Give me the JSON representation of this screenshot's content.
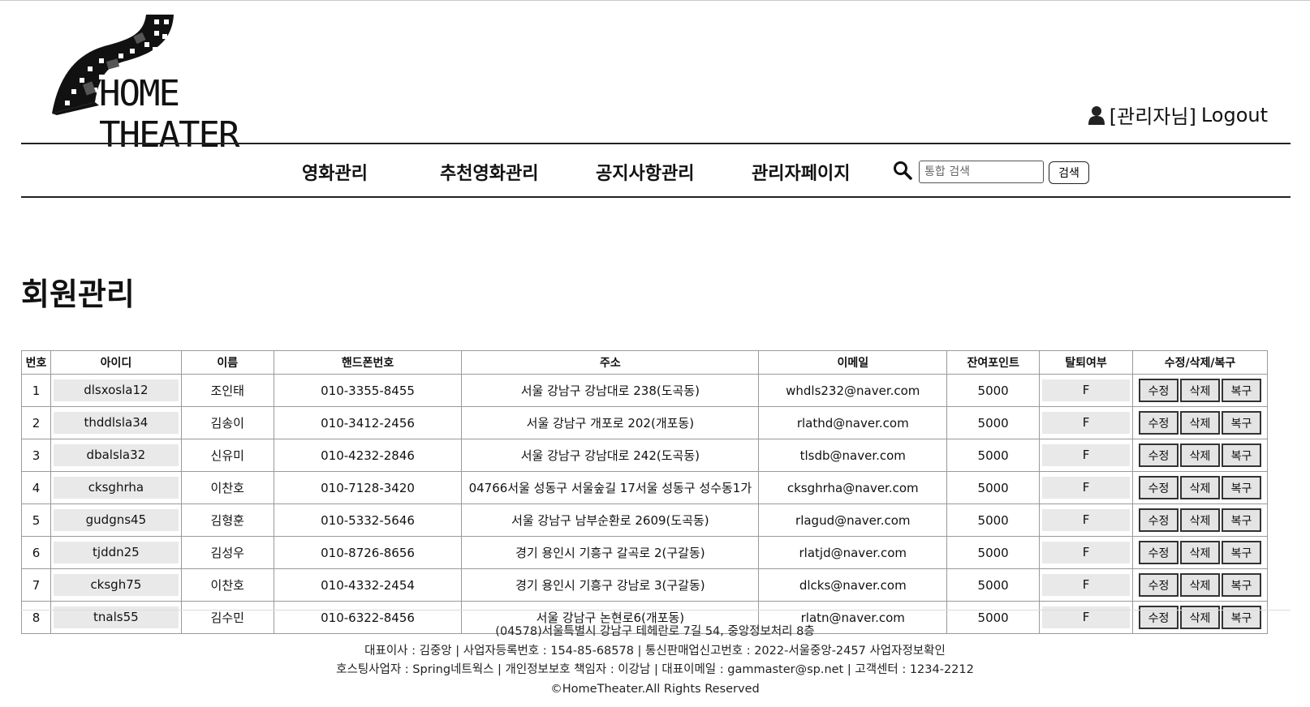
{
  "header": {
    "logo_text": "HOME THEATER",
    "user_label": "[관리자님]",
    "logout_label": "Logout"
  },
  "nav": {
    "items": [
      {
        "label": "영화관리"
      },
      {
        "label": "추천영화관리"
      },
      {
        "label": "공지사항관리"
      },
      {
        "label": "관리자페이지"
      }
    ],
    "search_placeholder": "통합 검색",
    "search_button": "검색"
  },
  "main": {
    "title": "회원관리"
  },
  "table": {
    "headers": [
      "번호",
      "아이디",
      "이름",
      "핸드폰번호",
      "주소",
      "이메일",
      "잔여포인트",
      "탈퇴여부",
      "수정/삭제/복구"
    ],
    "action_labels": {
      "edit": "수정",
      "delete": "삭제",
      "restore": "복구"
    },
    "rows": [
      {
        "no": "1",
        "id": "dlsxosla12",
        "name": "조인태",
        "phone": "010-3355-8455",
        "address": "서울 강남구 강남대로 238(도곡동)",
        "email": "whdls232@naver.com",
        "points": "5000",
        "withdrawn": "F"
      },
      {
        "no": "2",
        "id": "thddlsla34",
        "name": "김송이",
        "phone": "010-3412-2456",
        "address": "서울 강남구 개포로 202(개포동)",
        "email": "rlathd@naver.com",
        "points": "5000",
        "withdrawn": "F"
      },
      {
        "no": "3",
        "id": "dbalsla32",
        "name": "신유미",
        "phone": "010-4232-2846",
        "address": "서울 강남구 강남대로 242(도곡동)",
        "email": "tlsdb@naver.com",
        "points": "5000",
        "withdrawn": "F"
      },
      {
        "no": "4",
        "id": "cksghrha",
        "name": "이찬호",
        "phone": "010-7128-3420",
        "address": "04766서울 성동구 서울숲길 17서울 성동구 성수동1가",
        "email": "cksghrha@naver.com",
        "points": "5000",
        "withdrawn": "F"
      },
      {
        "no": "5",
        "id": "gudgns45",
        "name": "김형훈",
        "phone": "010-5332-5646",
        "address": "서울 강남구 남부순환로 2609(도곡동)",
        "email": "rlagud@naver.com",
        "points": "5000",
        "withdrawn": "F"
      },
      {
        "no": "6",
        "id": "tjddn25",
        "name": "김성우",
        "phone": "010-8726-8656",
        "address": "경기 용인시 기흥구 갈곡로 2(구갈동)",
        "email": "rlatjd@naver.com",
        "points": "5000",
        "withdrawn": "F"
      },
      {
        "no": "7",
        "id": "cksgh75",
        "name": "이찬호",
        "phone": "010-4332-2454",
        "address": "경기 용인시 기흥구 강남로 3(구갈동)",
        "email": "dlcks@naver.com",
        "points": "5000",
        "withdrawn": "F"
      },
      {
        "no": "8",
        "id": "tnals55",
        "name": "김수민",
        "phone": "010-6322-8456",
        "address": "서울 강남구 논현로6(개포동)",
        "email": "rlatn@naver.com",
        "points": "5000",
        "withdrawn": "F"
      }
    ]
  },
  "footer": {
    "lines": [
      "(04578)서울특별시 강남구 테헤란로 7길 54, 중앙정보처리 8층",
      "대표이사 : 김중앙 | 사업자등록번호 : 154-85-68578 | 통신판매업신고번호 : 2022-서울중앙-2457 사업자정보확인",
      "호스팅사업자 : Spring네트웍스 | 개인정보보호 책임자 : 이강남 | 대표이메일 : gammaster@sp.net | 고객센터 : 1234-2212",
      "©HomeTheater.All Rights Reserved"
    ]
  }
}
